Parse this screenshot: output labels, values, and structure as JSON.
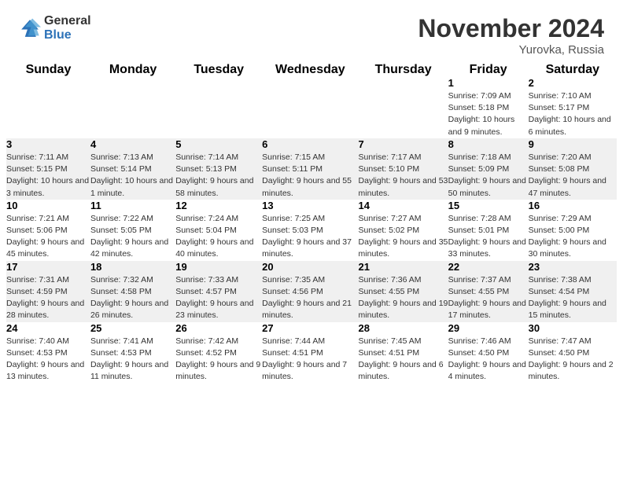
{
  "logo": {
    "general": "General",
    "blue": "Blue"
  },
  "title": "November 2024",
  "location": "Yurovka, Russia",
  "days_of_week": [
    "Sunday",
    "Monday",
    "Tuesday",
    "Wednesday",
    "Thursday",
    "Friday",
    "Saturday"
  ],
  "weeks": [
    [
      {
        "day": "",
        "info": "",
        "empty": true
      },
      {
        "day": "",
        "info": "",
        "empty": true
      },
      {
        "day": "",
        "info": "",
        "empty": true
      },
      {
        "day": "",
        "info": "",
        "empty": true
      },
      {
        "day": "",
        "info": "",
        "empty": true
      },
      {
        "day": "1",
        "info": "Sunrise: 7:09 AM\nSunset: 5:18 PM\nDaylight: 10 hours and 9 minutes."
      },
      {
        "day": "2",
        "info": "Sunrise: 7:10 AM\nSunset: 5:17 PM\nDaylight: 10 hours and 6 minutes."
      }
    ],
    [
      {
        "day": "3",
        "info": "Sunrise: 7:11 AM\nSunset: 5:15 PM\nDaylight: 10 hours and 3 minutes."
      },
      {
        "day": "4",
        "info": "Sunrise: 7:13 AM\nSunset: 5:14 PM\nDaylight: 10 hours and 1 minute."
      },
      {
        "day": "5",
        "info": "Sunrise: 7:14 AM\nSunset: 5:13 PM\nDaylight: 9 hours and 58 minutes."
      },
      {
        "day": "6",
        "info": "Sunrise: 7:15 AM\nSunset: 5:11 PM\nDaylight: 9 hours and 55 minutes."
      },
      {
        "day": "7",
        "info": "Sunrise: 7:17 AM\nSunset: 5:10 PM\nDaylight: 9 hours and 53 minutes."
      },
      {
        "day": "8",
        "info": "Sunrise: 7:18 AM\nSunset: 5:09 PM\nDaylight: 9 hours and 50 minutes."
      },
      {
        "day": "9",
        "info": "Sunrise: 7:20 AM\nSunset: 5:08 PM\nDaylight: 9 hours and 47 minutes."
      }
    ],
    [
      {
        "day": "10",
        "info": "Sunrise: 7:21 AM\nSunset: 5:06 PM\nDaylight: 9 hours and 45 minutes."
      },
      {
        "day": "11",
        "info": "Sunrise: 7:22 AM\nSunset: 5:05 PM\nDaylight: 9 hours and 42 minutes."
      },
      {
        "day": "12",
        "info": "Sunrise: 7:24 AM\nSunset: 5:04 PM\nDaylight: 9 hours and 40 minutes."
      },
      {
        "day": "13",
        "info": "Sunrise: 7:25 AM\nSunset: 5:03 PM\nDaylight: 9 hours and 37 minutes."
      },
      {
        "day": "14",
        "info": "Sunrise: 7:27 AM\nSunset: 5:02 PM\nDaylight: 9 hours and 35 minutes."
      },
      {
        "day": "15",
        "info": "Sunrise: 7:28 AM\nSunset: 5:01 PM\nDaylight: 9 hours and 33 minutes."
      },
      {
        "day": "16",
        "info": "Sunrise: 7:29 AM\nSunset: 5:00 PM\nDaylight: 9 hours and 30 minutes."
      }
    ],
    [
      {
        "day": "17",
        "info": "Sunrise: 7:31 AM\nSunset: 4:59 PM\nDaylight: 9 hours and 28 minutes."
      },
      {
        "day": "18",
        "info": "Sunrise: 7:32 AM\nSunset: 4:58 PM\nDaylight: 9 hours and 26 minutes."
      },
      {
        "day": "19",
        "info": "Sunrise: 7:33 AM\nSunset: 4:57 PM\nDaylight: 9 hours and 23 minutes."
      },
      {
        "day": "20",
        "info": "Sunrise: 7:35 AM\nSunset: 4:56 PM\nDaylight: 9 hours and 21 minutes."
      },
      {
        "day": "21",
        "info": "Sunrise: 7:36 AM\nSunset: 4:55 PM\nDaylight: 9 hours and 19 minutes."
      },
      {
        "day": "22",
        "info": "Sunrise: 7:37 AM\nSunset: 4:55 PM\nDaylight: 9 hours and 17 minutes."
      },
      {
        "day": "23",
        "info": "Sunrise: 7:38 AM\nSunset: 4:54 PM\nDaylight: 9 hours and 15 minutes."
      }
    ],
    [
      {
        "day": "24",
        "info": "Sunrise: 7:40 AM\nSunset: 4:53 PM\nDaylight: 9 hours and 13 minutes."
      },
      {
        "day": "25",
        "info": "Sunrise: 7:41 AM\nSunset: 4:53 PM\nDaylight: 9 hours and 11 minutes."
      },
      {
        "day": "26",
        "info": "Sunrise: 7:42 AM\nSunset: 4:52 PM\nDaylight: 9 hours and 9 minutes."
      },
      {
        "day": "27",
        "info": "Sunrise: 7:44 AM\nSunset: 4:51 PM\nDaylight: 9 hours and 7 minutes."
      },
      {
        "day": "28",
        "info": "Sunrise: 7:45 AM\nSunset: 4:51 PM\nDaylight: 9 hours and 6 minutes."
      },
      {
        "day": "29",
        "info": "Sunrise: 7:46 AM\nSunset: 4:50 PM\nDaylight: 9 hours and 4 minutes."
      },
      {
        "day": "30",
        "info": "Sunrise: 7:47 AM\nSunset: 4:50 PM\nDaylight: 9 hours and 2 minutes."
      }
    ]
  ]
}
